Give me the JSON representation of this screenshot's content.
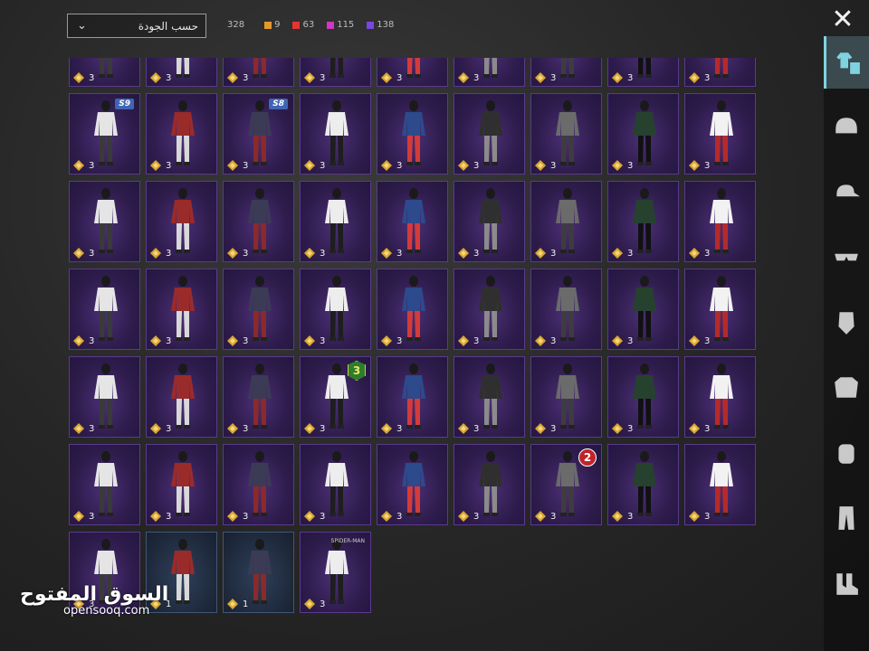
{
  "sort": {
    "label": "حسب الجودة"
  },
  "counts": {
    "total": "328",
    "tiers": [
      {
        "value": "9",
        "color": "#e29a2b"
      },
      {
        "value": "63",
        "color": "#e53434"
      },
      {
        "value": "115",
        "color": "#d236c4"
      },
      {
        "value": "138",
        "color": "#7b45e0"
      }
    ]
  },
  "close_icon": "close-icon",
  "items": [
    {
      "qty": "3"
    },
    {
      "qty": "3"
    },
    {
      "qty": "3"
    },
    {
      "qty": "3"
    },
    {
      "qty": "3"
    },
    {
      "qty": "3"
    },
    {
      "qty": "3"
    },
    {
      "qty": "3"
    },
    {
      "qty": "3"
    },
    {
      "qty": "3",
      "season": "S9"
    },
    {
      "qty": "3"
    },
    {
      "qty": "3",
      "season": "S8"
    },
    {
      "qty": "3"
    },
    {
      "qty": "3"
    },
    {
      "qty": "3"
    },
    {
      "qty": "3"
    },
    {
      "qty": "3"
    },
    {
      "qty": "3"
    },
    {
      "qty": "3"
    },
    {
      "qty": "3"
    },
    {
      "qty": "3"
    },
    {
      "qty": "3"
    },
    {
      "qty": "3"
    },
    {
      "qty": "3"
    },
    {
      "qty": "3"
    },
    {
      "qty": "3"
    },
    {
      "qty": "3"
    },
    {
      "qty": "3"
    },
    {
      "qty": "3"
    },
    {
      "qty": "3"
    },
    {
      "qty": "3"
    },
    {
      "qty": "3"
    },
    {
      "qty": "3"
    },
    {
      "qty": "3"
    },
    {
      "qty": "3"
    },
    {
      "qty": "3"
    },
    {
      "qty": "3"
    },
    {
      "qty": "3"
    },
    {
      "qty": "3"
    },
    {
      "qty": "3",
      "level": "3",
      "level_style": "green"
    },
    {
      "qty": "3"
    },
    {
      "qty": "3"
    },
    {
      "qty": "3"
    },
    {
      "qty": "3"
    },
    {
      "qty": "3"
    },
    {
      "qty": "3"
    },
    {
      "qty": "3"
    },
    {
      "qty": "3"
    },
    {
      "qty": "3"
    },
    {
      "qty": "3"
    },
    {
      "qty": "3"
    },
    {
      "qty": "3",
      "level": "2",
      "level_style": "red"
    },
    {
      "qty": "3"
    },
    {
      "qty": "3"
    },
    {
      "qty": "3"
    },
    {
      "qty": "1",
      "rarity": "blue"
    },
    {
      "qty": "1",
      "rarity": "blue"
    },
    {
      "qty": "3",
      "cover": "SPIDER-MAN"
    }
  ],
  "sidebar_tabs": [
    {
      "icon": "outfit-icon",
      "active": true
    },
    {
      "icon": "helmet-icon"
    },
    {
      "icon": "cap-icon"
    },
    {
      "icon": "glasses-icon"
    },
    {
      "icon": "mask-icon"
    },
    {
      "icon": "jacket-icon"
    },
    {
      "icon": "backpack-icon"
    },
    {
      "icon": "pants-icon"
    },
    {
      "icon": "shoes-icon"
    }
  ],
  "watermark": {
    "arabic": "السوق المفتوح",
    "latin": "opensooq.com"
  }
}
